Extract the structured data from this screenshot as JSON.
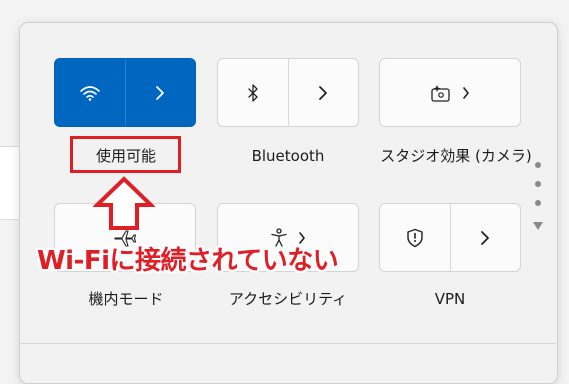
{
  "tiles": {
    "wifi": {
      "label": "使用可能",
      "icon": "wifi-icon",
      "state": "on"
    },
    "bluetooth": {
      "label": "Bluetooth",
      "icon": "bluetooth-icon"
    },
    "studio_effects": {
      "label": "スタジオ効果 (カメラ)",
      "icon": "studio-effects-icon"
    },
    "airplane": {
      "label": "機内モード",
      "icon": "airplane-icon"
    },
    "accessibility": {
      "label": "アクセシビリティ",
      "icon": "accessibility-icon"
    },
    "vpn": {
      "label": "VPN",
      "icon": "vpn-shield-icon"
    }
  },
  "annotation": {
    "text": "Wi-Fiに接続されていない",
    "color": "#e01e26"
  },
  "colors": {
    "accent": "#0067c0",
    "panel_bg": "#f2f2f2",
    "tile_bg": "#fbfbfb"
  },
  "pager": {
    "dots": 3,
    "current": 1
  }
}
